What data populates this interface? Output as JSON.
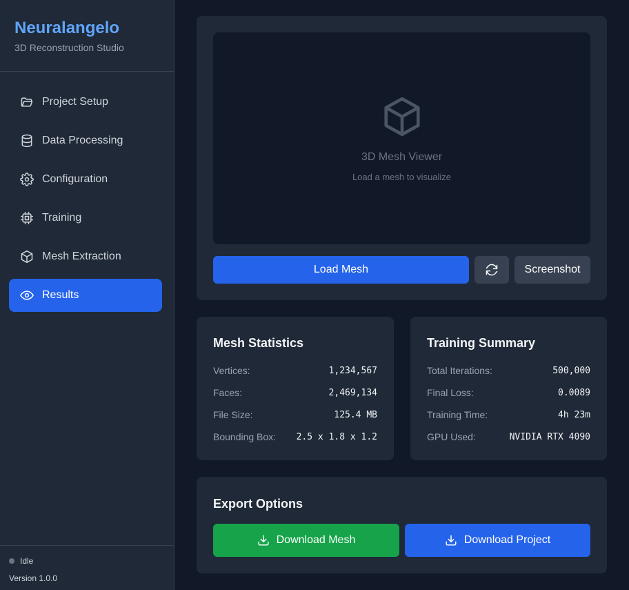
{
  "app": {
    "title": "Neuralangelo",
    "subtitle": "3D Reconstruction Studio"
  },
  "sidebar": {
    "items": [
      {
        "label": "Project Setup",
        "icon": "folder-open-icon",
        "active": false
      },
      {
        "label": "Data Processing",
        "icon": "database-icon",
        "active": false
      },
      {
        "label": "Configuration",
        "icon": "gear-icon",
        "active": false
      },
      {
        "label": "Training",
        "icon": "cpu-icon",
        "active": false
      },
      {
        "label": "Mesh Extraction",
        "icon": "cube-icon",
        "active": false
      },
      {
        "label": "Results",
        "icon": "eye-icon",
        "active": true
      }
    ],
    "status": "Idle",
    "version": "Version 1.0.0"
  },
  "viewer": {
    "title": "3D Mesh Viewer",
    "subtitle": "Load a mesh to visualize",
    "load_button": "Load Mesh",
    "screenshot_button": "Screenshot"
  },
  "mesh_stats": {
    "title": "Mesh Statistics",
    "rows": [
      {
        "label": "Vertices:",
        "value": "1,234,567"
      },
      {
        "label": "Faces:",
        "value": "2,469,134"
      },
      {
        "label": "File Size:",
        "value": "125.4 MB"
      },
      {
        "label": "Bounding Box:",
        "value": "2.5 x 1.8 x 1.2"
      }
    ]
  },
  "training_summary": {
    "title": "Training Summary",
    "rows": [
      {
        "label": "Total Iterations:",
        "value": "500,000"
      },
      {
        "label": "Final Loss:",
        "value": "0.0089"
      },
      {
        "label": "Training Time:",
        "value": "4h 23m"
      },
      {
        "label": "GPU Used:",
        "value": "NVIDIA RTX 4090"
      }
    ]
  },
  "export": {
    "title": "Export Options",
    "download_mesh": "Download Mesh",
    "download_project": "Download Project"
  },
  "colors": {
    "accent": "#2563eb",
    "brand": "#60a5fa",
    "success": "#16a34a",
    "background": "#111827",
    "panel": "#1f2937"
  }
}
